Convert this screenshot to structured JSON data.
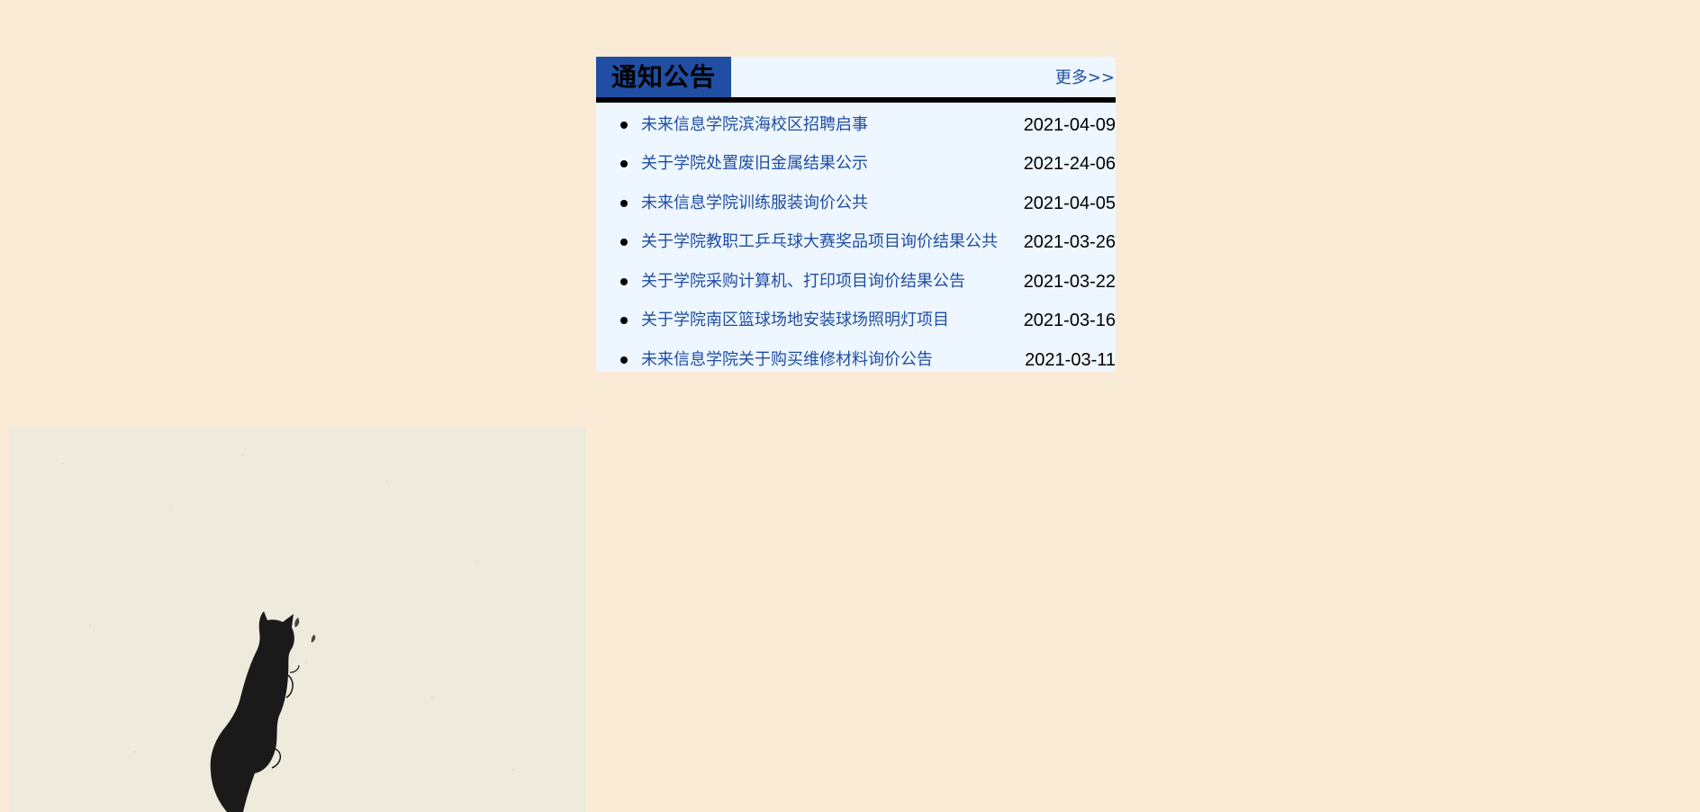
{
  "notice": {
    "title": "通知公告",
    "more_label": "更多>>",
    "items": [
      {
        "title": "未来信息学院滨海校区招聘启事",
        "date": "2021-04-09"
      },
      {
        "title": "关于学院处置废旧金属结果公示",
        "date": "2021-24-06"
      },
      {
        "title": "未来信息学院训练服装询价公共",
        "date": "2021-04-05"
      },
      {
        "title": "关于学院教职工乒乓球大赛奖品项目询价结果公共",
        "date": "2021-03-26"
      },
      {
        "title": "关于学院采购计算机、打印项目询价结果公告",
        "date": "2021-03-22"
      },
      {
        "title": "关于学院南区篮球场地安装球场照明灯项目",
        "date": "2021-03-16"
      },
      {
        "title": "未来信息学院关于购买维修材料询价公告",
        "date": "2021-03-11"
      }
    ]
  },
  "colors": {
    "page_background": "#faebd7",
    "panel_background": "#eef6ff",
    "title_background": "#1f4ea3",
    "link_color": "#1f4ea3",
    "picture_background": "#eeeadc",
    "cat_color": "#1a1a1a"
  }
}
